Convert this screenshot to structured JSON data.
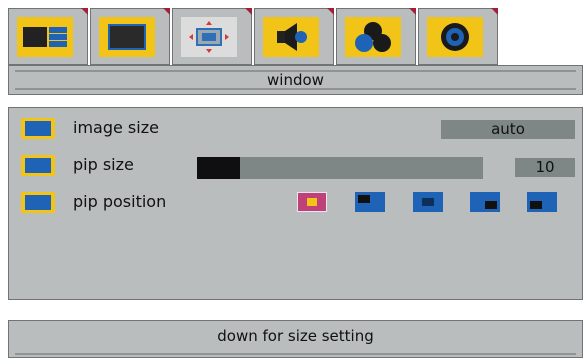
{
  "tabs": [
    {
      "icon": "screen-layout-icon",
      "active": false
    },
    {
      "icon": "monitor-icon",
      "active": false
    },
    {
      "icon": "window-resize-icon",
      "active": true
    },
    {
      "icon": "speaker-icon",
      "active": false
    },
    {
      "icon": "color-circles-icon",
      "active": false
    },
    {
      "icon": "gear-icon",
      "active": false
    }
  ],
  "window_title": "window",
  "settings": {
    "image_size": {
      "label": "image size",
      "value": "auto"
    },
    "pip_size": {
      "label": "pip size",
      "value": "10",
      "level": 0.15
    },
    "pip_position": {
      "label": "pip position",
      "options": [
        "center",
        "top-left",
        "center-alt",
        "bottom-right",
        "bottom-left"
      ],
      "selected": 0
    }
  },
  "status": {
    "message": "down for size setting"
  },
  "colors": {
    "panel": "#b9bdbd",
    "accent": "#f2c418",
    "icon_blue": "#1e63b6",
    "value_box": "#7f8686",
    "selected_option": "#c0407a"
  }
}
